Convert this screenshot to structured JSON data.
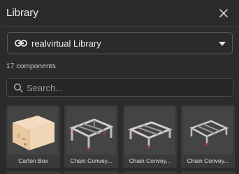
{
  "header": {
    "title": "Library",
    "close_icon": "close-icon"
  },
  "library_selector": {
    "icon": "link-icon",
    "selected": "realvirtual Library",
    "caret_icon": "caret-down-icon"
  },
  "component_count": "17 components",
  "search": {
    "icon": "search-icon",
    "placeholder": "Search...",
    "value": ""
  },
  "components": [
    {
      "name": "Carton Box",
      "thumbnail": "carton-box"
    },
    {
      "name": "Chain Convey...",
      "thumbnail": "chain-conveyor"
    },
    {
      "name": "Chain Convey...",
      "thumbnail": "chain-conveyor"
    },
    {
      "name": "Chain Convey...",
      "thumbnail": "chain-conveyor"
    }
  ],
  "colors": {
    "panel_bg": "#2b2b2b",
    "card_bg": "#3a3a3a",
    "thumb_bg": "#444444",
    "text": "#e6e6e6",
    "muted": "#9a9a9a"
  }
}
